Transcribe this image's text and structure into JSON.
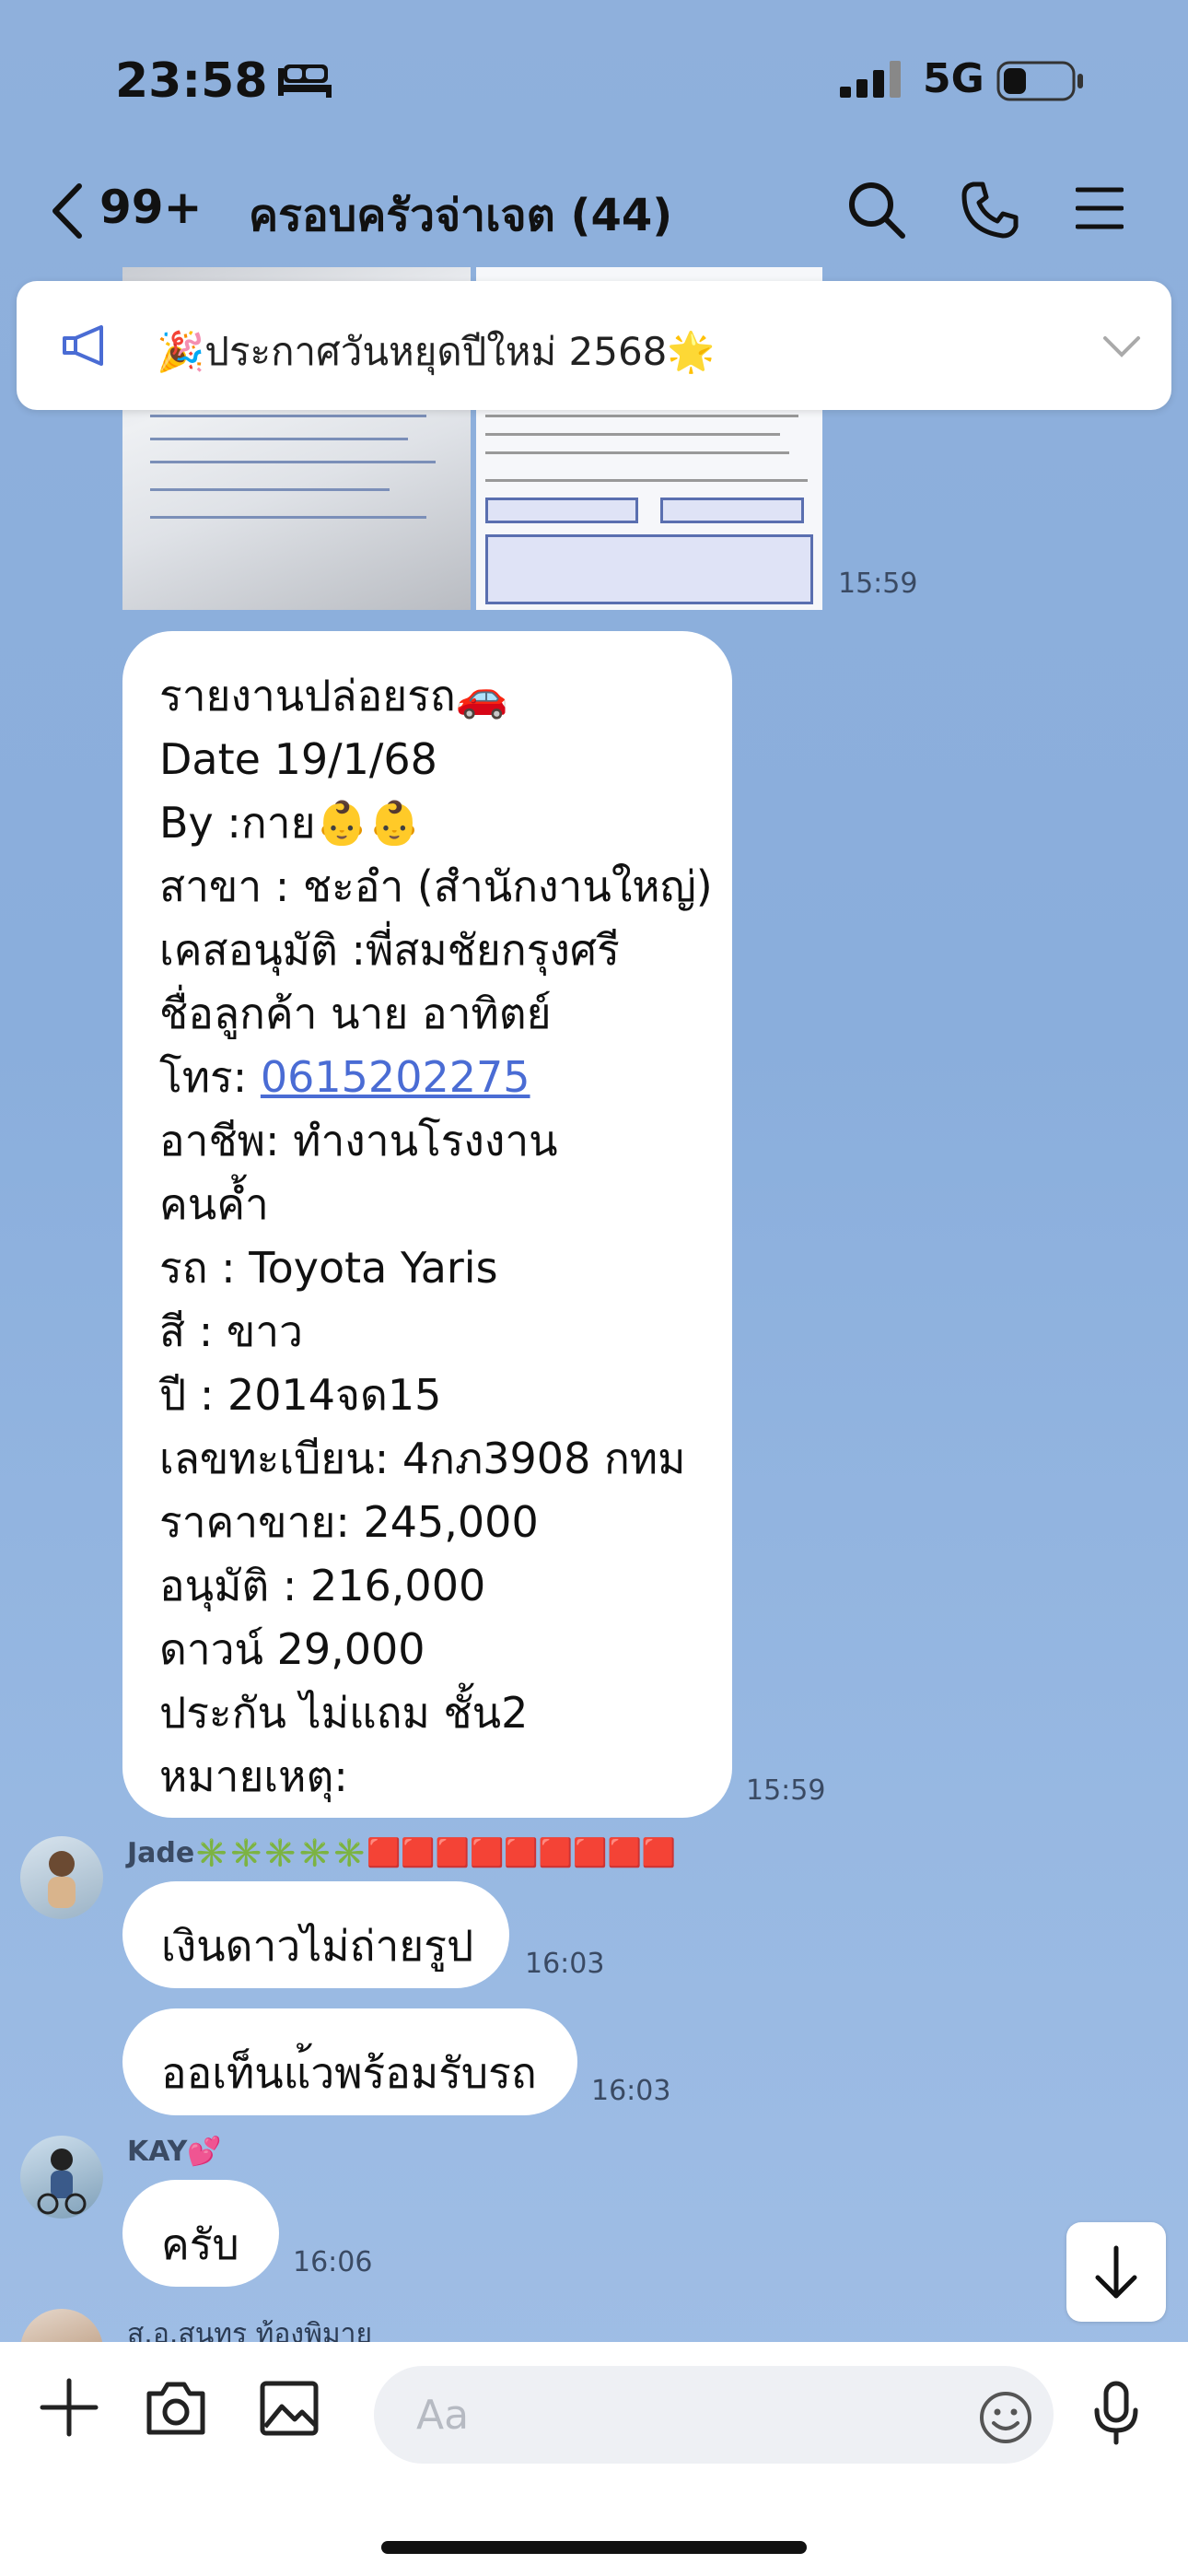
{
  "status_bar": {
    "time": "23:58",
    "network": "5G"
  },
  "header": {
    "back_count": "99+",
    "title": "ครอบครัวจ่าเจต (44)"
  },
  "announcement": {
    "text": "🎉ประกาศวันหยุดปีใหม่ 2568🌟"
  },
  "image_message": {
    "time": "15:59"
  },
  "report_message": {
    "lines": [
      "รายงานปล่อยรถ🚗",
      "Date 19/1/68",
      "By :กาย👶👶",
      "สาขา : ชะอำ (สำนักงานใหญ่)",
      "เคสอนุมัติ :พี่สมชัยกรุงศรี",
      "ชื่อลูกค้า นาย อาทิตย์",
      "โทร: ",
      "อาชีพ: ทำงานโรงงาน",
      "คนค้ำ",
      "รถ : Toyota Yaris",
      "สี : ขาว",
      "ปี : 2014จด15",
      "เลขทะเบียน: 4กภ3908 กทม",
      "ราคาขาย: 245,000",
      "อนุมัติ : 216,000",
      "ดาวน์ 29,000",
      "ประกัน ไม่แถม ชั้น2",
      "หมายเหตุ:"
    ],
    "phone": "0615202275",
    "time": "15:59"
  },
  "messages": [
    {
      "sender": "Jade✳️✳️✳️✳️✳️🟥🟥🟥🟥🟥🟥🟥🟥🟥",
      "text": "เงินดาวไม่ถ่ายรูป",
      "time": "16:03"
    },
    {
      "text": "ออเท็นแ้วพร้อมรับรถ",
      "time": "16:03"
    },
    {
      "sender": "KAY💕",
      "text": "ครับ",
      "time": "16:06"
    },
    {
      "sender": "ส.อ.สุนทร ท้องพิมาย"
    }
  ],
  "input": {
    "placeholder": "Aa"
  },
  "colors": {
    "link": "#4a6cd4",
    "background": "#8fb0dc"
  }
}
